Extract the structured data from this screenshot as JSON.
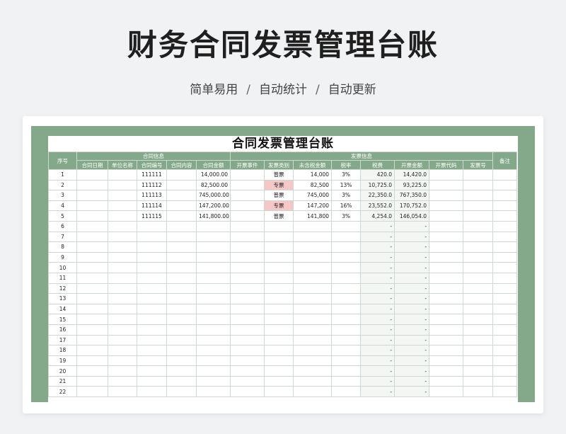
{
  "page": {
    "title": "财务合同发票管理台账",
    "subtitle_parts": [
      "简单易用",
      "自动统计",
      "自动更新"
    ],
    "separator": "/"
  },
  "sheet": {
    "title": "合同发票管理台账",
    "groups": {
      "seq": "序号",
      "contract": "合同信息",
      "invoice": "发票信息",
      "note": "备注"
    },
    "columns": [
      "合同日期",
      "单位名称",
      "合同编号",
      "合同内容",
      "合同金额",
      "开票事件",
      "发票类别",
      "未含税金额",
      "税率",
      "税费",
      "开票金额",
      "开票代码",
      "发票号"
    ],
    "rows": [
      {
        "no": "1",
        "contract_no": "111111",
        "contract_amount": "14,000.00",
        "invoice_type": "普票",
        "highlight": false,
        "net_amount": "14,000",
        "tax_rate": "3%",
        "tax": "420.0",
        "invoice_amount": "14,420.0"
      },
      {
        "no": "2",
        "contract_no": "111112",
        "contract_amount": "82,500.00",
        "invoice_type": "专票",
        "highlight": true,
        "net_amount": "82,500",
        "tax_rate": "13%",
        "tax": "10,725.0",
        "invoice_amount": "93,225.0"
      },
      {
        "no": "3",
        "contract_no": "111113",
        "contract_amount": "745,000.00",
        "invoice_type": "普票",
        "highlight": false,
        "net_amount": "745,000",
        "tax_rate": "3%",
        "tax": "22,350.0",
        "invoice_amount": "767,350.0"
      },
      {
        "no": "4",
        "contract_no": "111114",
        "contract_amount": "147,200.00",
        "invoice_type": "专票",
        "highlight": true,
        "net_amount": "147,200",
        "tax_rate": "16%",
        "tax": "23,552.0",
        "invoice_amount": "170,752.0"
      },
      {
        "no": "5",
        "contract_no": "111115",
        "contract_amount": "141,800.00",
        "invoice_type": "普票",
        "highlight": false,
        "net_amount": "141,800",
        "tax_rate": "3%",
        "tax": "4,254.0",
        "invoice_amount": "146,054.0"
      }
    ],
    "empty_rows": [
      "6",
      "7",
      "8",
      "9",
      "10",
      "11",
      "12",
      "13",
      "14",
      "15",
      "16",
      "17",
      "18",
      "19",
      "20",
      "21",
      "22"
    ],
    "empty_calc_placeholder": "-"
  },
  "colors": {
    "header_green": "#84a98a",
    "pink_highlight": "#f6c7c7"
  }
}
